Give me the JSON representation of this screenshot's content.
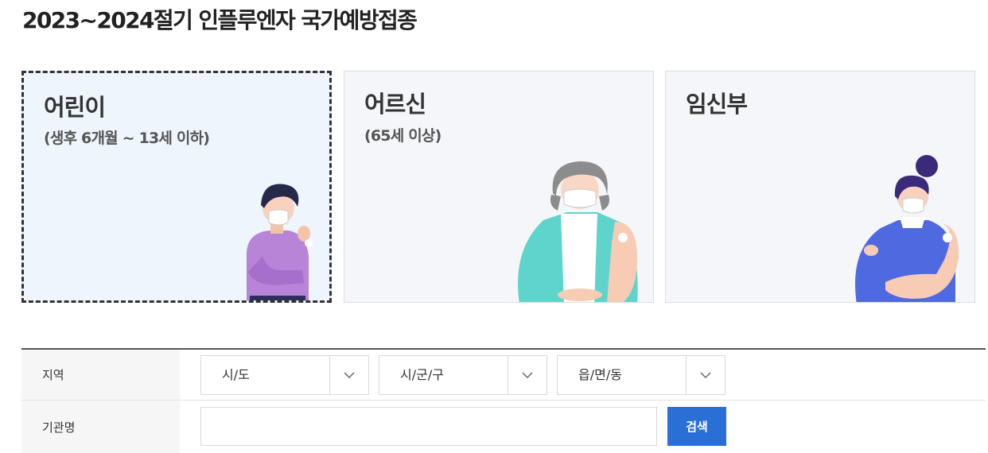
{
  "page": {
    "title": "2023~2024절기 인플루엔자 국가예방접종"
  },
  "cards": [
    {
      "title": "어린이",
      "subtitle": "(생후 6개월 ~ 13세 이하)",
      "selected": true
    },
    {
      "title": "어르신",
      "subtitle": "(65세 이상)",
      "selected": false
    },
    {
      "title": "임신부",
      "subtitle": "",
      "selected": false
    }
  ],
  "form": {
    "region_label": "지역",
    "region_selects": [
      {
        "value": "시/도",
        "icon": "chevron-down-icon"
      },
      {
        "value": "시/군/구",
        "icon": "chevron-down-icon"
      },
      {
        "value": "읍/면/동",
        "icon": "chevron-down-icon"
      }
    ],
    "org_label": "기관명",
    "org_input": {
      "value": "",
      "placeholder": ""
    },
    "search_label": "검색"
  },
  "colors": {
    "accent": "#2a6fd6",
    "selected_bg": "#eef5fd",
    "card_bg": "#f4f6f9"
  }
}
